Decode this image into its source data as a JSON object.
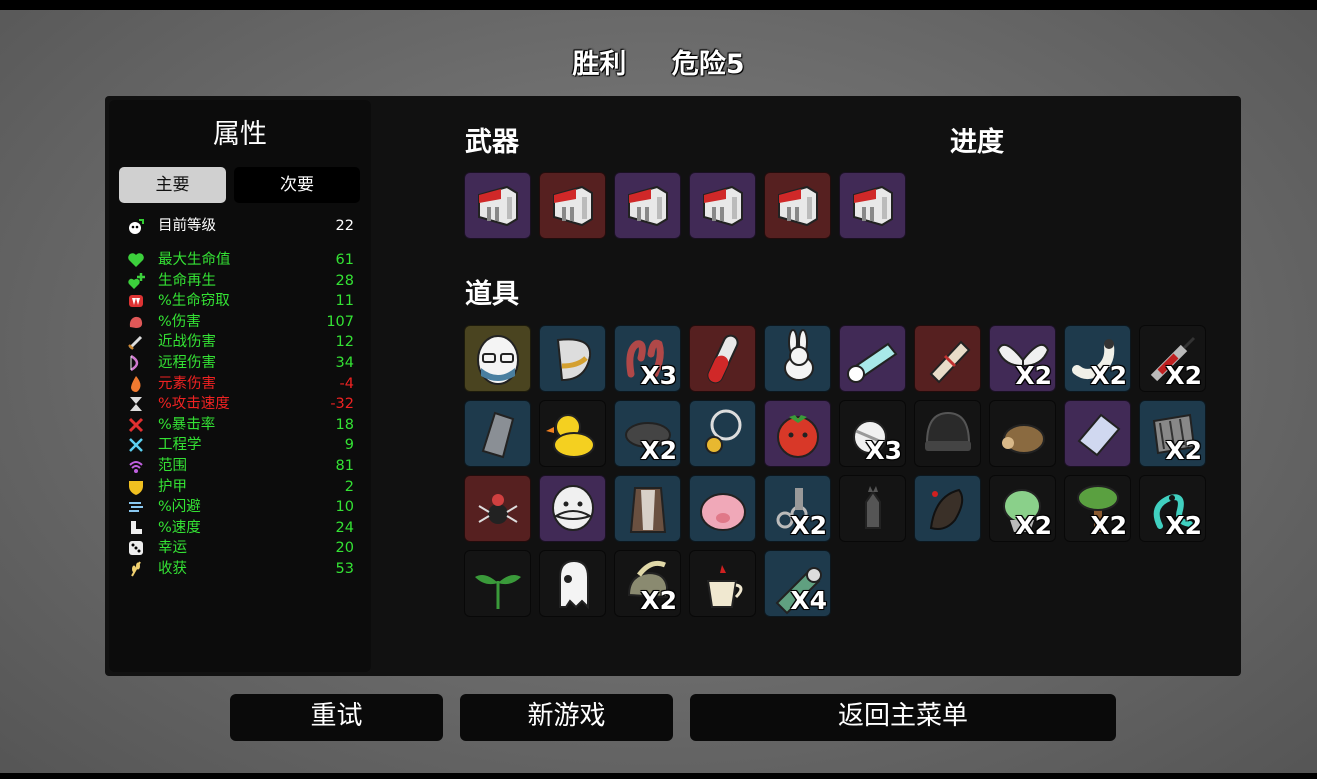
{
  "header": {
    "result": "胜利",
    "danger": "危险5"
  },
  "stats_panel": {
    "title": "属性",
    "tab_primary": "主要",
    "tab_secondary": "次要",
    "level": {
      "name": "目前等级",
      "value": "22"
    },
    "items": [
      {
        "name": "最大生命值",
        "value": "61",
        "color": "#34e234",
        "icon": "heart-icon"
      },
      {
        "name": "生命再生",
        "value": "28",
        "color": "#34e234",
        "icon": "regen-icon"
      },
      {
        "name": "%生命窃取",
        "value": "11",
        "color": "#34e234",
        "icon": "fangs-icon"
      },
      {
        "name": "%伤害",
        "value": "107",
        "color": "#34e234",
        "icon": "muscle-icon"
      },
      {
        "name": "近战伤害",
        "value": "12",
        "color": "#34e234",
        "icon": "sword-icon"
      },
      {
        "name": "远程伤害",
        "value": "34",
        "color": "#34e234",
        "icon": "bow-icon"
      },
      {
        "name": "元素伤害",
        "value": "-4",
        "color": "#ee2222",
        "icon": "fire-icon"
      },
      {
        "name": "%攻击速度",
        "value": "-32",
        "color": "#ee2222",
        "icon": "hourglass-icon"
      },
      {
        "name": "%暴击率",
        "value": "18",
        "color": "#34e234",
        "icon": "crit-icon"
      },
      {
        "name": "工程学",
        "value": "9",
        "color": "#34e234",
        "icon": "wrench-icon"
      },
      {
        "name": "范围",
        "value": "81",
        "color": "#34e234",
        "icon": "range-icon"
      },
      {
        "name": "护甲",
        "value": "2",
        "color": "#34e234",
        "icon": "shield-icon"
      },
      {
        "name": "%闪避",
        "value": "10",
        "color": "#34e234",
        "icon": "dodge-icon"
      },
      {
        "name": "%速度",
        "value": "24",
        "color": "#34e234",
        "icon": "boot-icon"
      },
      {
        "name": "幸运",
        "value": "20",
        "color": "#34e234",
        "icon": "dice-icon"
      },
      {
        "name": "收获",
        "value": "53",
        "color": "#34e234",
        "icon": "wheat-icon"
      }
    ]
  },
  "weapons": {
    "title": "武器",
    "items": [
      {
        "name": "megaphone",
        "tier": "purple",
        "count": ""
      },
      {
        "name": "megaphone",
        "tier": "red",
        "count": ""
      },
      {
        "name": "megaphone",
        "tier": "purple",
        "count": ""
      },
      {
        "name": "megaphone",
        "tier": "purple",
        "count": ""
      },
      {
        "name": "megaphone",
        "tier": "red",
        "count": ""
      },
      {
        "name": "megaphone",
        "tier": "purple",
        "count": ""
      }
    ]
  },
  "progress": {
    "title": "进度"
  },
  "items_section": {
    "title": "道具",
    "items": [
      {
        "name": "egg-glasses",
        "tier": "gold",
        "count": ""
      },
      {
        "name": "helmet-visor",
        "tier": "blue",
        "count": ""
      },
      {
        "name": "worm",
        "tier": "blue",
        "count": "X3"
      },
      {
        "name": "potion-vial",
        "tier": "red",
        "count": ""
      },
      {
        "name": "rabbit",
        "tier": "blue",
        "count": ""
      },
      {
        "name": "scope",
        "tier": "purple",
        "count": ""
      },
      {
        "name": "scroll",
        "tier": "red",
        "count": ""
      },
      {
        "name": "wings",
        "tier": "purple",
        "count": "X2"
      },
      {
        "name": "grub",
        "tier": "blue",
        "count": "X2"
      },
      {
        "name": "syringe",
        "tier": "black",
        "count": "X2"
      },
      {
        "name": "gauntlet",
        "tier": "blue",
        "count": ""
      },
      {
        "name": "duck",
        "tier": "black",
        "count": ""
      },
      {
        "name": "beret",
        "tier": "blue",
        "count": "X2"
      },
      {
        "name": "pendant",
        "tier": "blue",
        "count": ""
      },
      {
        "name": "tomato",
        "tier": "purple",
        "count": ""
      },
      {
        "name": "bandage",
        "tier": "black",
        "count": "X3"
      },
      {
        "name": "beanie",
        "tier": "black",
        "count": ""
      },
      {
        "name": "hedgehog",
        "tier": "black",
        "count": ""
      },
      {
        "name": "eraser",
        "tier": "purple",
        "count": ""
      },
      {
        "name": "coil",
        "tier": "blue",
        "count": "X2"
      },
      {
        "name": "spider",
        "tier": "red",
        "count": ""
      },
      {
        "name": "mustache-face",
        "tier": "purple",
        "count": ""
      },
      {
        "name": "armor-vest",
        "tier": "blue",
        "count": ""
      },
      {
        "name": "piggy-bank",
        "tier": "blue",
        "count": ""
      },
      {
        "name": "chains",
        "tier": "blue",
        "count": "X2"
      },
      {
        "name": "bat",
        "tier": "black",
        "count": ""
      },
      {
        "name": "leech",
        "tier": "blue",
        "count": ""
      },
      {
        "name": "lettuce",
        "tier": "black",
        "count": "X2"
      },
      {
        "name": "tree",
        "tier": "black",
        "count": "X2"
      },
      {
        "name": "alien-worm",
        "tier": "black",
        "count": "X2"
      },
      {
        "name": "sprout",
        "tier": "black",
        "count": ""
      },
      {
        "name": "ghost",
        "tier": "black",
        "count": ""
      },
      {
        "name": "horn-snail",
        "tier": "black",
        "count": "X2"
      },
      {
        "name": "coffee-cup",
        "tier": "black",
        "count": ""
      },
      {
        "name": "scope-tube",
        "tier": "blue",
        "count": "X4"
      }
    ]
  },
  "buttons": {
    "retry": "重试",
    "new_game": "新游戏",
    "main_menu": "返回主菜单"
  },
  "colors": {
    "purple": "#412a56",
    "red": "#562020",
    "blue": "#1e3a4c",
    "gold": "#4a4420",
    "black": "#141414"
  }
}
